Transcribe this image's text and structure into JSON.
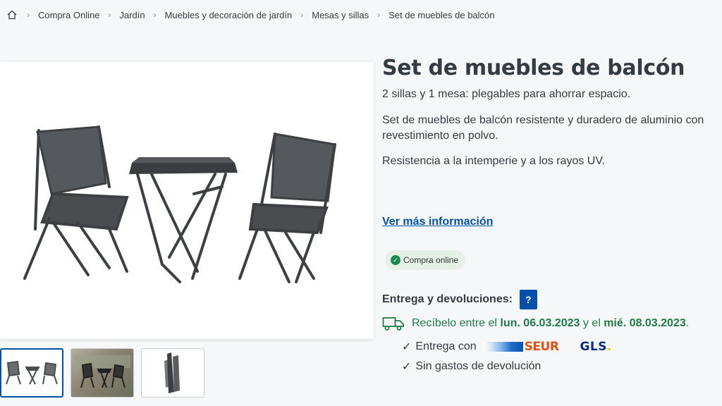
{
  "breadcrumb": {
    "home_icon": "home-icon",
    "items": [
      "Compra Online",
      "Jardín",
      "Muebles y decoración de jardín",
      "Mesas y sillas",
      "Set de muebles de balcón"
    ]
  },
  "product": {
    "title": "Set de muebles de balcón",
    "subtitle": "2 sillas y 1 mesa: plegables para ahorrar espacio.",
    "description": "Set de muebles de balcón resistente y duradero de aluminio con revestimiento en polvo.",
    "description2": "Resistencia a la intemperie y a los rayos UV.",
    "more_info_link": "Ver más información",
    "badge": "Compra online"
  },
  "delivery": {
    "label": "Entrega y devoluciones:",
    "help": "?",
    "receive_prefix": "Recíbelo entre el",
    "date_from": "lun. 06.03.2023",
    "and": "y el",
    "date_to": "mié. 08.03.2023",
    "period": ".",
    "tick": "✓",
    "delivery_with": "Entrega con",
    "carrier1": "SEUR",
    "carrier2": "GLS",
    "carrier2_dot": ".",
    "no_return_cost": "Sin gastos de devolución"
  },
  "colors": {
    "accent": "#0050aa",
    "success": "#1e7a45",
    "seur": "#e84e0f",
    "gls": "#0a2a8c"
  }
}
